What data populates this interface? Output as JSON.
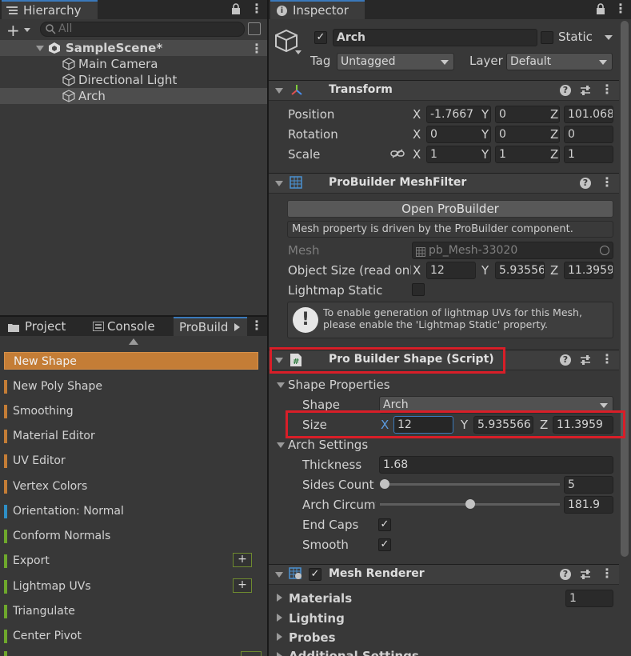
{
  "hierarchy": {
    "tab_label": "Hierarchy",
    "search_placeholder": "All",
    "scene_name": "SampleScene*",
    "objects": [
      "Main Camera",
      "Directional Light",
      "Arch"
    ]
  },
  "bottom_tabs": {
    "project": "Project",
    "console": "Console",
    "probuilder": "ProBuild"
  },
  "probuilder_menu": [
    {
      "label": "New Shape",
      "color": "#c47d36",
      "selected": true
    },
    {
      "label": "New Poly Shape",
      "color": "#c47d36"
    },
    {
      "label": "Smoothing",
      "color": "#c47d36"
    },
    {
      "label": "Material Editor",
      "color": "#c47d36"
    },
    {
      "label": "UV Editor",
      "color": "#c47d36"
    },
    {
      "label": "Vertex Colors",
      "color": "#c47d36"
    },
    {
      "label": "Orientation: Normal",
      "color": "#2e8fc6"
    },
    {
      "label": "Conform Normals",
      "color": "#6ea82c"
    },
    {
      "label": "Export",
      "color": "#6ea82c",
      "plus": "+"
    },
    {
      "label": "Lightmap UVs",
      "color": "#6ea82c",
      "plus": "+"
    },
    {
      "label": "Triangulate",
      "color": "#6ea82c"
    },
    {
      "label": "Center Pivot",
      "color": "#6ea82c"
    }
  ],
  "inspector": {
    "tab_label": "Inspector",
    "object_name": "Arch",
    "static_label": "Static",
    "tag_label": "Tag",
    "tag_value": "Untagged",
    "layer_label": "Layer",
    "layer_value": "Default",
    "transform": {
      "title": "Transform",
      "position_label": "Position",
      "rotation_label": "Rotation",
      "scale_label": "Scale",
      "position": {
        "x": "-1.7667",
        "y": "0",
        "z": "101.068"
      },
      "rotation": {
        "x": "0",
        "y": "0",
        "z": "0"
      },
      "scale": {
        "x": "1",
        "y": "1",
        "z": "1"
      }
    },
    "meshfilter": {
      "title": "ProBuilder MeshFilter",
      "open_button": "Open ProBuilder",
      "driven_note": "Mesh property is driven by the ProBuilder component.",
      "mesh_label": "Mesh",
      "mesh_value": "pb_Mesh-33020",
      "object_size_label": "Object Size (read only)",
      "object_size": {
        "x": "12",
        "y": "5.93556",
        "z": "11.3959"
      },
      "lightmap_static_label": "Lightmap Static",
      "lightmap_info": "To enable generation of lightmap UVs for this Mesh, please enable the 'Lightmap Static' property."
    },
    "shape": {
      "title": "Pro Builder Shape (Script)",
      "shape_properties_label": "Shape Properties",
      "shape_label": "Shape",
      "shape_value": "Arch",
      "size_label": "Size",
      "size": {
        "x": "12",
        "y": "5.935566",
        "z": "11.3959"
      },
      "arch_settings_label": "Arch Settings",
      "thickness_label": "Thickness",
      "thickness_value": "1.68",
      "sides_count_label": "Sides Count",
      "sides_count_value": "5",
      "sides_count_fraction": 0.0,
      "arch_circ_label": "Arch Circumference",
      "arch_circ_value": "181.9",
      "arch_circ_fraction": 0.5,
      "end_caps_label": "End Caps",
      "smooth_label": "Smooth"
    },
    "mesh_renderer": {
      "title": "Mesh Renderer",
      "materials_label": "Materials",
      "materials_count": "1",
      "lighting_label": "Lighting",
      "probes_label": "Probes",
      "additional_label": "Additional Settings"
    },
    "axis": {
      "x": "X",
      "y": "Y",
      "z": "Z"
    }
  },
  "colors": {
    "accent_blue": "#3a79bb",
    "highlight_red": "#d91e28",
    "selected_orange": "#c47d36"
  }
}
